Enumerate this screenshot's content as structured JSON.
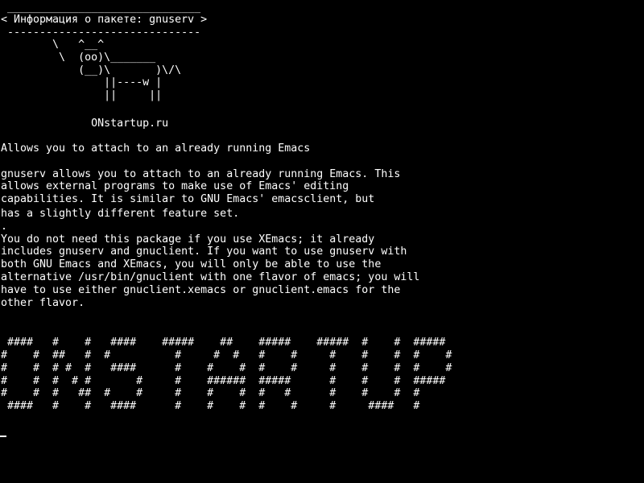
{
  "terminal": {
    "bubble": {
      "top_border": " ______________________________",
      "title": "< Информация о пакете: gnuserv >",
      "bottom_border": " ------------------------------"
    },
    "cow_lines": [
      "        \\   ^__^",
      "         \\  (oo)\\_______",
      "            (__)\\       )\\/\\",
      "                ||----w |",
      "                ||     ||"
    ],
    "site_name": "              ONstartup.ru",
    "short_description": "Allows you to attach to an already running Emacs",
    "long_description": [
      "gnuserv allows you to attach to an already running Emacs. This",
      "allows external programs to make use of Emacs' editing",
      "capabilities. It is similar to GNU Emacs' emacsclient, but",
      "has a slightly different feature set.",
      ".",
      "You do not need this package if you use XEmacs; it already",
      "includes gnuserv and gnuclient. If you want to use gnuserv with",
      "both GNU Emacs and XEmacs, you will only be able to use the",
      "alternative /usr/bin/gnuclient with one flavor of emacs; you will",
      "have to use either gnuclient.xemacs or gnuclient.emacs for the",
      "other flavor."
    ],
    "banner_lines": [
      " ####   #    #   ####    #####    ##    #####    #####  #    #  #####",
      "#    #  ##   #  #          #     #  #   #    #     #    #    #  #    #",
      "#    #  # #  #   ####      #    #    #  #    #     #    #    #  #    #",
      "#    #  #  # #       #     #    ######  #####      #    #    #  #####",
      "#    #  #   ##  #    #     #    #    #  #   #      #    #    #  #",
      " ####   #    #   ####      #    #    #  #    #     #     ####   #"
    ]
  }
}
